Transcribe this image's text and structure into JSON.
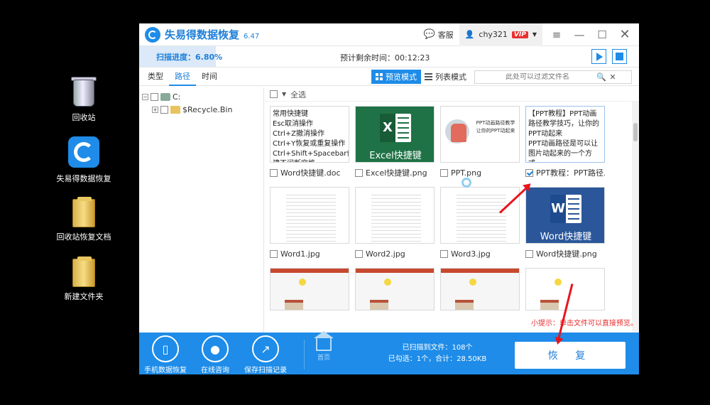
{
  "desktop": {
    "icons": [
      {
        "label": "回收站"
      },
      {
        "label": "失易得数据恢复"
      },
      {
        "label": "回收站恢复文档"
      },
      {
        "label": "新建文件夹"
      }
    ]
  },
  "titlebar": {
    "app_name": "失易得数据恢复",
    "version": "6.47",
    "service": "客服",
    "username": "chy321",
    "vip_badge": "VIP"
  },
  "progress": {
    "label": "扫描进度：6.80%",
    "remaining": "预计剩余时间：00:12:23",
    "percent": 6.8
  },
  "tabs": [
    {
      "label": "类型",
      "active": false
    },
    {
      "label": "路径",
      "active": true
    },
    {
      "label": "时间",
      "active": false
    }
  ],
  "view_modes": {
    "preview": "预览模式",
    "list": "列表模式"
  },
  "search": {
    "placeholder": "此处可以过滤文件名"
  },
  "tree": [
    {
      "label": "C:",
      "expander": "−"
    },
    {
      "label": "$Recycle.Bin",
      "expander": "+"
    }
  ],
  "select_all": "全选",
  "files": [
    {
      "name": "Word快捷键.doc",
      "preview_text": "常用快捷键\nEsc取消操作\nCtrl+Z撤消操作\nCtrl+Y恢复或重复操作\nCtrl+Shift+Spacebar创\n建不间断空格\n",
      "checked": false
    },
    {
      "name": "Excel快捷键.png",
      "preview_text": "Excel快捷键",
      "checked": false
    },
    {
      "name": "PPT.png",
      "preview_text": "PPT动画路径教学\n让你的PPT动起来",
      "checked": false
    },
    {
      "name": "PPT教程：PPT路径...",
      "preview_text": "【PPT教程】PPT动画路径教学技巧，让你的PPT动起来\nPPT动画路径是可以让图片动起来的一个方式，",
      "checked": true
    },
    {
      "name": "Word1.jpg",
      "checked": false
    },
    {
      "name": "Word2.jpg",
      "checked": false
    },
    {
      "name": "Word3.jpg",
      "checked": false
    },
    {
      "name": "Word快捷键.png",
      "preview_text": "Word快捷键",
      "checked": false
    }
  ],
  "tip": "小提示：单击文件可以直接预览。",
  "footer": {
    "buttons": [
      "手机数据恢复",
      "在线咨询",
      "保存扫描记录"
    ],
    "home": "首页",
    "scanned": "已扫描到文件：108个",
    "selected": "已勾选：1个，合计：28.50KB",
    "restore": "恢 复"
  },
  "colors": {
    "accent": "#1e8ce8",
    "annotation_red": "#e8141c",
    "vip_red": "#e8302f"
  }
}
